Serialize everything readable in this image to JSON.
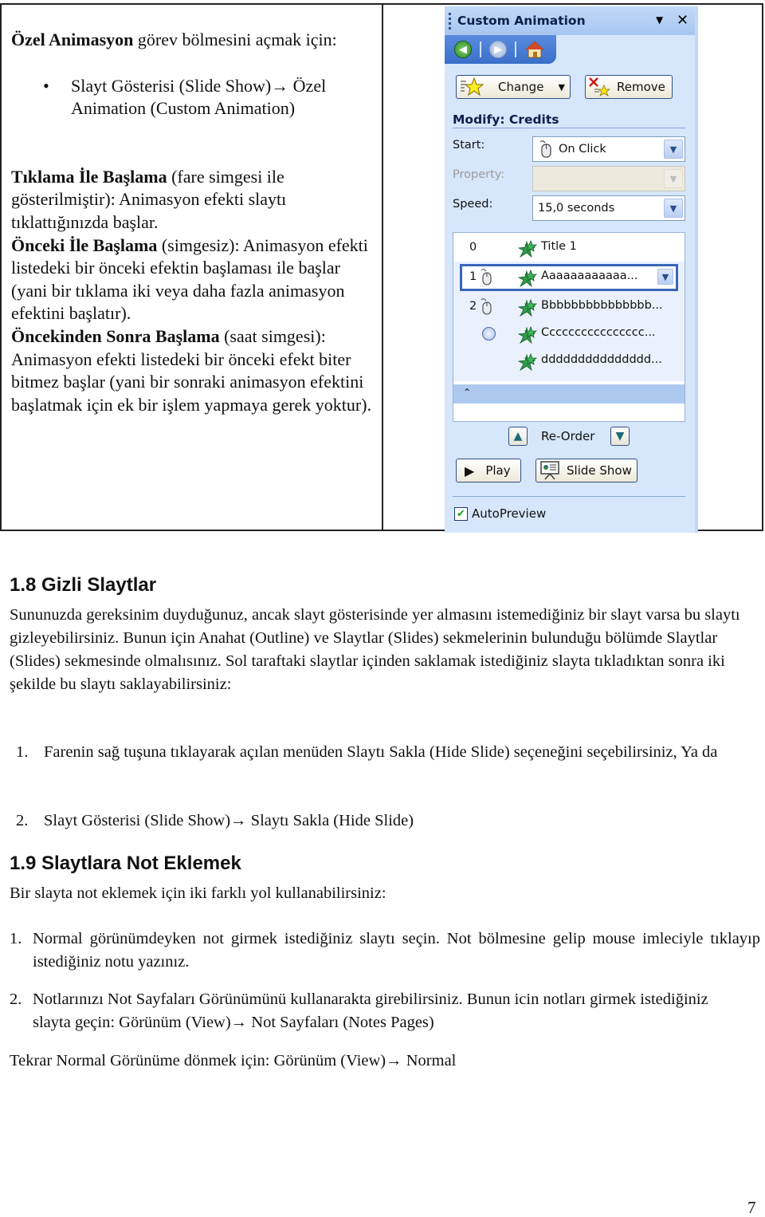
{
  "left_cell": {
    "intro_bold": "Özel Animasyon",
    "intro_rest": " görev bölmesini açmak için:",
    "bullet": "Slayt Gösterisi (Slide Show)→ Özel Animation (Custom Animation)",
    "p1_bold": "Tıklama İle Başlama",
    "p1_rest": " (fare simgesi ile gösterilmiştir): Animasyon efekti slaytı tıklattığınızda başlar.",
    "p2_bold": "Önceki İle Başlama",
    "p2_rest": " (simgesiz): Animasyon efekti listedeki bir önceki efektin başlaması ile başlar (yani bir tıklama iki veya daha fazla animasyon efektini başlatır).",
    "p3_bold": "Öncekinden Sonra Başlama",
    "p3_rest": " (saat simgesi): Animasyon efekti listedeki bir önceki efekt biter bitmez başlar (yani bir sonraki animasyon efektini başlatmak için ek bir işlem yapmaya gerek yoktur)."
  },
  "task_pane": {
    "title": "Custom Animation",
    "menu_glyph": "▼",
    "close_glyph": "✕",
    "nav": {
      "back": "back-icon",
      "forward": "forward-icon",
      "home": "home-icon"
    },
    "change_label": "Change",
    "remove_label": "Remove",
    "modify_label": "Modify: Credits",
    "start_label": "Start:",
    "start_value": "On Click",
    "property_label": "Property:",
    "property_value": "",
    "speed_label": "Speed:",
    "speed_value": "15,0 seconds",
    "animation_list": [
      {
        "num": "0",
        "trigger": "none",
        "text": "Title 1"
      },
      {
        "num": "1",
        "trigger": "on-click",
        "text": "Aaaaaaaaaaaa...",
        "selected": true
      },
      {
        "num": "2",
        "trigger": "on-click",
        "text": "Bbbbbbbbbbbbbbb..."
      },
      {
        "num": "",
        "trigger": "after-previous",
        "text": "Cccccccccccccccc..."
      },
      {
        "num": "",
        "trigger": "with-previous",
        "text": "ddddddddddddddd..."
      }
    ],
    "collapse_glyph": "⌃",
    "reorder_label": "Re-Order",
    "play_label": "Play",
    "slideshow_label": "Slide Show",
    "autopreview_label": "AutoPreview",
    "autopreview_checked": true
  },
  "section_18": {
    "heading": "1.8 Gizli Slaytlar",
    "paragraph": "Sununuzda gereksinim duyduğunuz, ancak slayt gösterisinde yer almasını istemediğiniz bir slayt varsa bu slaytı gizleyebilirsiniz. Bunun için Anahat (Outline) ve Slaytlar (Slides) sekmelerinin bulunduğu bölümde Slaytlar (Slides) sekmesinde olmalısınız. Sol taraftaki slaytlar içinden saklamak istediğiniz slayta tıkladıktan sonra iki şekilde bu slaytı saklayabilirsiniz:",
    "items": [
      {
        "num": "1.",
        "text": "Farenin sağ tuşuna tıklayarak açılan menüden Slaytı Sakla (Hide Slide)  seçeneğini seçebilirsiniz, Ya da"
      },
      {
        "num": "2.",
        "text": "Slayt Gösterisi (Slide Show)→ Slaytı Sakla (Hide Slide)"
      }
    ]
  },
  "section_19": {
    "heading": "1.9 Slaytlara Not Eklemek",
    "intro": "Bir slayta not eklemek için iki farklı yol kullanabilirsiniz:",
    "items": [
      {
        "num": "1.",
        "text": "Normal görünümdeyken not girmek istediğiniz slaytı seçin. Not bölmesine gelip mouse imleciyle tıklayıp istediğiniz notu yazınız."
      },
      {
        "num": "2.",
        "text": "Notlarınızı Not Sayfaları Görünümünü kullanarakta girebilirsiniz. Bunun icin notları girmek istediğiniz slayta geçin: Görünüm (View)→ Not Sayfaları (Notes Pages)"
      }
    ],
    "closing": "Tekrar Normal Görünüme dönmek için: Görünüm (View)→ Normal"
  },
  "page_number": "7"
}
